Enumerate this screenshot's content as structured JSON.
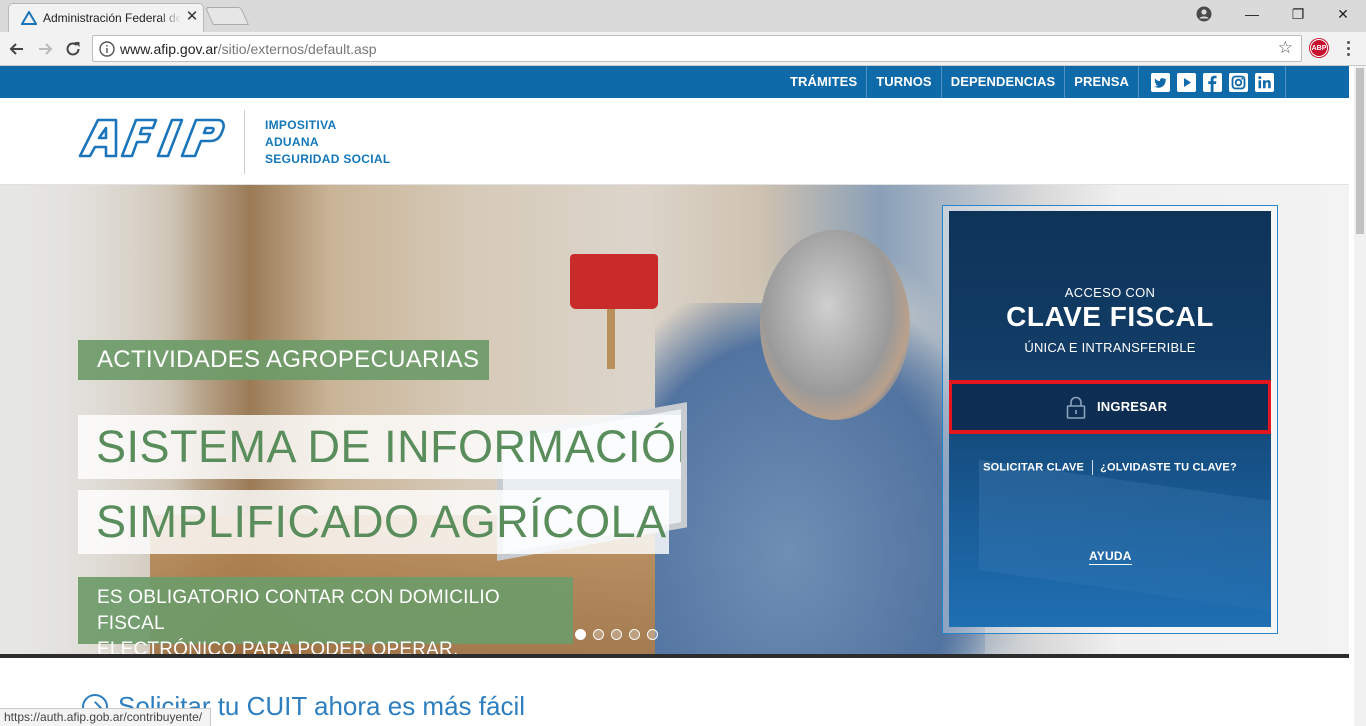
{
  "browser": {
    "tab_title": "Administración Federal de Ingresos Públicos",
    "tab_close": "✕",
    "url_host": "www.afip.gov.ar",
    "url_path": "/sitio/externos/default.asp",
    "bookmark_icon": "☆",
    "extension_label": "ABP",
    "status_url": "https://auth.afip.gob.ar/contribuyente/",
    "window_controls": {
      "minimize": "—",
      "maximize": "❐",
      "close": "✕"
    }
  },
  "topnav": {
    "items": [
      "TRÁMITES",
      "TURNOS",
      "DEPENDENCIAS",
      "PRENSA"
    ],
    "social": [
      "twitter-icon",
      "youtube-icon",
      "facebook-icon",
      "instagram-icon",
      "linkedin-icon"
    ]
  },
  "header": {
    "taglines": [
      "IMPOSITIVA",
      "ADUANA",
      "SEGURIDAD SOCIAL"
    ]
  },
  "hero": {
    "category": "ACTIVIDADES AGROPECUARIAS",
    "title_line1": "SISTEMA DE INFORMACIÓN",
    "title_line2": "SIMPLIFICADO AGRÍCOLA",
    "note_line1": "ES OBLIGATORIO CONTAR CON DOMICILIO FISCAL",
    "note_line2": "ELECTRÓNICO PARA PODER OPERAR.",
    "slides_total": 5,
    "slide_active": 1
  },
  "login": {
    "pre_title": "ACCESO CON",
    "title": "CLAVE FISCAL",
    "subtitle": "ÚNICA E INTRANSFERIBLE",
    "button_label": "INGRESAR",
    "link_request": "SOLICITAR CLAVE",
    "link_forgot": "¿OLVIDASTE TU CLAVE?",
    "link_help": "AYUDA"
  },
  "below": {
    "cuit_link": "Solicitar tu CUIT ahora es más fácil"
  },
  "colors": {
    "brand_blue": "#0f6aa9",
    "green_label": "#6e9b69",
    "login_dark": "#0d2e52",
    "highlight": "#e3161f"
  }
}
